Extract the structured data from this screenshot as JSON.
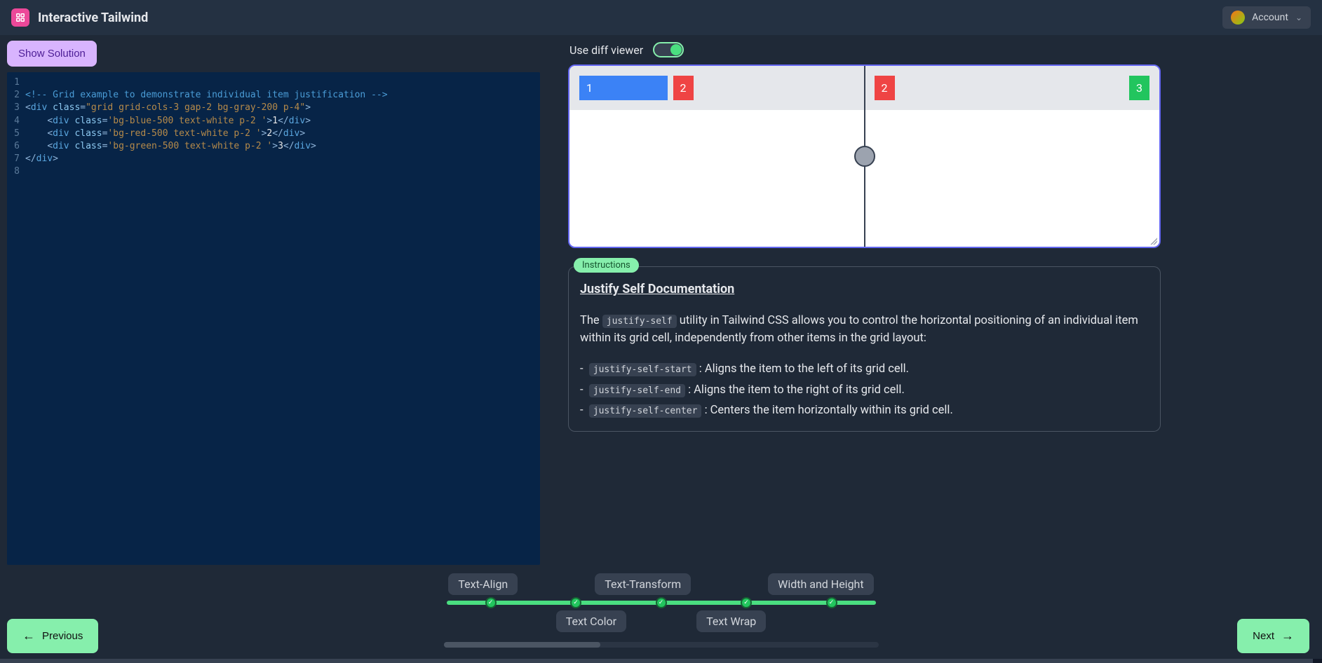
{
  "header": {
    "brand": "Interactive Tailwind",
    "account_label": "Account"
  },
  "toolbar": {
    "show_solution": "Show Solution",
    "diff_label": "Use diff viewer"
  },
  "editor_lines": [
    {
      "n": "1",
      "tokens": []
    },
    {
      "n": "2",
      "tokens": [
        {
          "t": "comment",
          "v": "<!-- Grid example to demonstrate individual item justification -->"
        }
      ]
    },
    {
      "n": "3",
      "tokens": [
        {
          "t": "punct",
          "v": "<"
        },
        {
          "t": "tag",
          "v": "div"
        },
        {
          "t": "text",
          "v": " "
        },
        {
          "t": "attr",
          "v": "class"
        },
        {
          "t": "punct",
          "v": "="
        },
        {
          "t": "string",
          "v": "\"grid grid-cols-3 gap-2 bg-gray-200 p-4\""
        },
        {
          "t": "punct",
          "v": ">"
        }
      ]
    },
    {
      "n": "4",
      "tokens": [
        {
          "t": "text",
          "v": "    "
        },
        {
          "t": "punct",
          "v": "<"
        },
        {
          "t": "tag",
          "v": "div"
        },
        {
          "t": "text",
          "v": " "
        },
        {
          "t": "attr",
          "v": "class"
        },
        {
          "t": "punct",
          "v": "="
        },
        {
          "t": "string",
          "v": "'bg-blue-500 text-white p-2 '"
        },
        {
          "t": "punct",
          "v": ">"
        },
        {
          "t": "text",
          "v": "1"
        },
        {
          "t": "punct",
          "v": "</"
        },
        {
          "t": "tag",
          "v": "div"
        },
        {
          "t": "punct",
          "v": ">"
        }
      ]
    },
    {
      "n": "5",
      "tokens": [
        {
          "t": "text",
          "v": "    "
        },
        {
          "t": "punct",
          "v": "<"
        },
        {
          "t": "tag",
          "v": "div"
        },
        {
          "t": "text",
          "v": " "
        },
        {
          "t": "attr",
          "v": "class"
        },
        {
          "t": "punct",
          "v": "="
        },
        {
          "t": "string",
          "v": "'bg-red-500 text-white p-2 '"
        },
        {
          "t": "punct",
          "v": ">"
        },
        {
          "t": "text",
          "v": "2"
        },
        {
          "t": "punct",
          "v": "</"
        },
        {
          "t": "tag",
          "v": "div"
        },
        {
          "t": "punct",
          "v": ">"
        }
      ]
    },
    {
      "n": "6",
      "tokens": [
        {
          "t": "text",
          "v": "    "
        },
        {
          "t": "punct",
          "v": "<"
        },
        {
          "t": "tag",
          "v": "div"
        },
        {
          "t": "text",
          "v": " "
        },
        {
          "t": "attr",
          "v": "class"
        },
        {
          "t": "punct",
          "v": "="
        },
        {
          "t": "string",
          "v": "'bg-green-500 text-white p-2 '"
        },
        {
          "t": "punct",
          "v": ">"
        },
        {
          "t": "text",
          "v": "3"
        },
        {
          "t": "punct",
          "v": "</"
        },
        {
          "t": "tag",
          "v": "div"
        },
        {
          "t": "punct",
          "v": ">"
        }
      ]
    },
    {
      "n": "7",
      "tokens": [
        {
          "t": "punct",
          "v": "</"
        },
        {
          "t": "tag",
          "v": "div"
        },
        {
          "t": "punct",
          "v": ">"
        }
      ]
    },
    {
      "n": "8",
      "tokens": []
    }
  ],
  "preview": {
    "left": [
      "1",
      "2"
    ],
    "right": [
      "2",
      "3"
    ]
  },
  "instructions": {
    "badge": "Instructions",
    "title": "Justify Self Documentation",
    "intro_pre": "The ",
    "intro_code": "justify-self",
    "intro_post": " utility in Tailwind CSS allows you to control the horizontal positioning of an individual item within its grid cell, independently from other items in the grid layout:",
    "items": [
      {
        "code": "justify-self-start",
        "desc": ": Aligns the item to the left of its grid cell."
      },
      {
        "code": "justify-self-end",
        "desc": ": Aligns the item to the right of its grid cell."
      },
      {
        "code": "justify-self-center",
        "desc": ": Centers the item horizontally within its grid cell."
      }
    ]
  },
  "progress": {
    "top_labels": [
      "Text-Align",
      "Text-Transform",
      "Width and Height"
    ],
    "bottom_labels": [
      "Text Color",
      "Text Wrap"
    ]
  },
  "nav": {
    "prev": "Previous",
    "next": "Next"
  }
}
